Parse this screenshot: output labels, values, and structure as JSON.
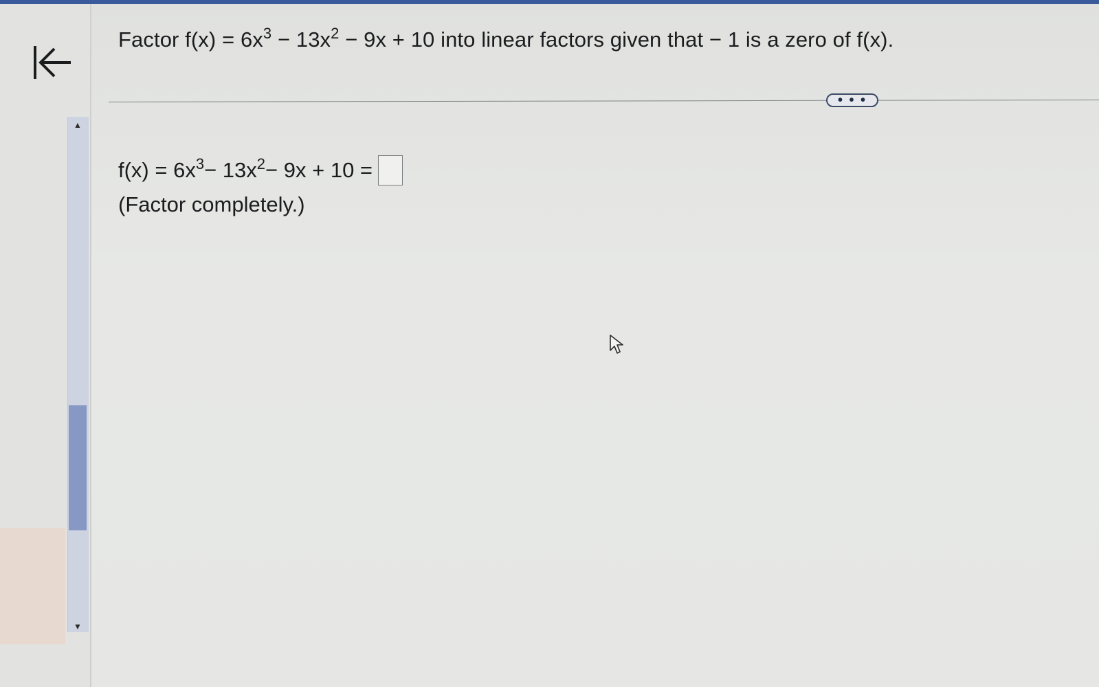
{
  "question": {
    "prefix": "Factor f(x) = 6x",
    "exp1": "3",
    "mid1": " − 13x",
    "exp2": "2",
    "suffix": " − 9x + 10 into linear factors given that − 1 is a zero of f(x)."
  },
  "more_button": {
    "label": "• • •"
  },
  "answer": {
    "lhs_prefix": "f(x) = 6x",
    "exp1": "3",
    "mid1": " − 13x",
    "exp2": "2",
    "suffix": " − 9x + 10 ="
  },
  "instruction": "(Factor completely.)",
  "colors": {
    "accent": "#3a5a9c",
    "scroll_thumb": "#8898c4",
    "background": "#e4e5e3"
  }
}
